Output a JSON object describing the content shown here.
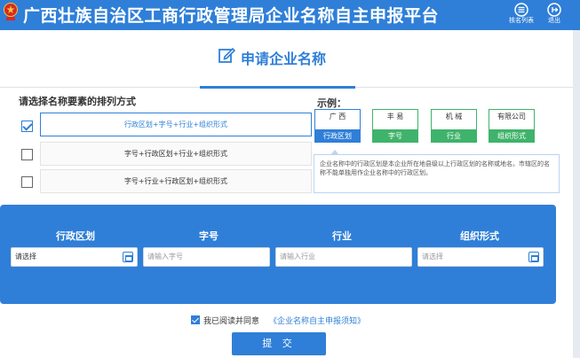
{
  "header": {
    "title": "广西壮族自治区工商行政管理局企业名称自主申报平台",
    "home_label": "核名列表",
    "exit_label": "退出"
  },
  "page": {
    "heading": "申请企业名称"
  },
  "arrangement": {
    "label": "请选择名称要素的排列方式",
    "options": [
      {
        "label": "行政区划+字号+行业+组织形式",
        "checked": true
      },
      {
        "label": "字号+行政区划+行业+组织形式",
        "checked": false
      },
      {
        "label": "字号+行业+行政区划+组织形式",
        "checked": false
      }
    ]
  },
  "example": {
    "label": "示例：",
    "cards": [
      {
        "text": "广 西",
        "caption": "行政区划"
      },
      {
        "text": "丰 易",
        "caption": "字号"
      },
      {
        "text": "机 械",
        "caption": "行业"
      },
      {
        "text": "有限公司",
        "caption": "组织形式"
      }
    ],
    "note": "企业名称中的行政区划是本企业所在地县级以上行政区划的名称或地名。市辖区的名称不能单独用作企业名称中的行政区划。"
  },
  "form": {
    "fields": [
      {
        "title": "行政区划",
        "value": "请选择",
        "placeholder": ""
      },
      {
        "title": "字号",
        "value": "",
        "placeholder": "请输入字号"
      },
      {
        "title": "行业",
        "value": "",
        "placeholder": "请输入行业"
      },
      {
        "title": "组织形式",
        "value": "",
        "placeholder": "请选择"
      }
    ]
  },
  "agreement": {
    "text": "我已阅读并同意",
    "link": "《企业名称自主申报须知》"
  },
  "submit_label": "提 交",
  "colors": {
    "primary": "#2f7fd8",
    "example_green": "#3fb36b"
  }
}
